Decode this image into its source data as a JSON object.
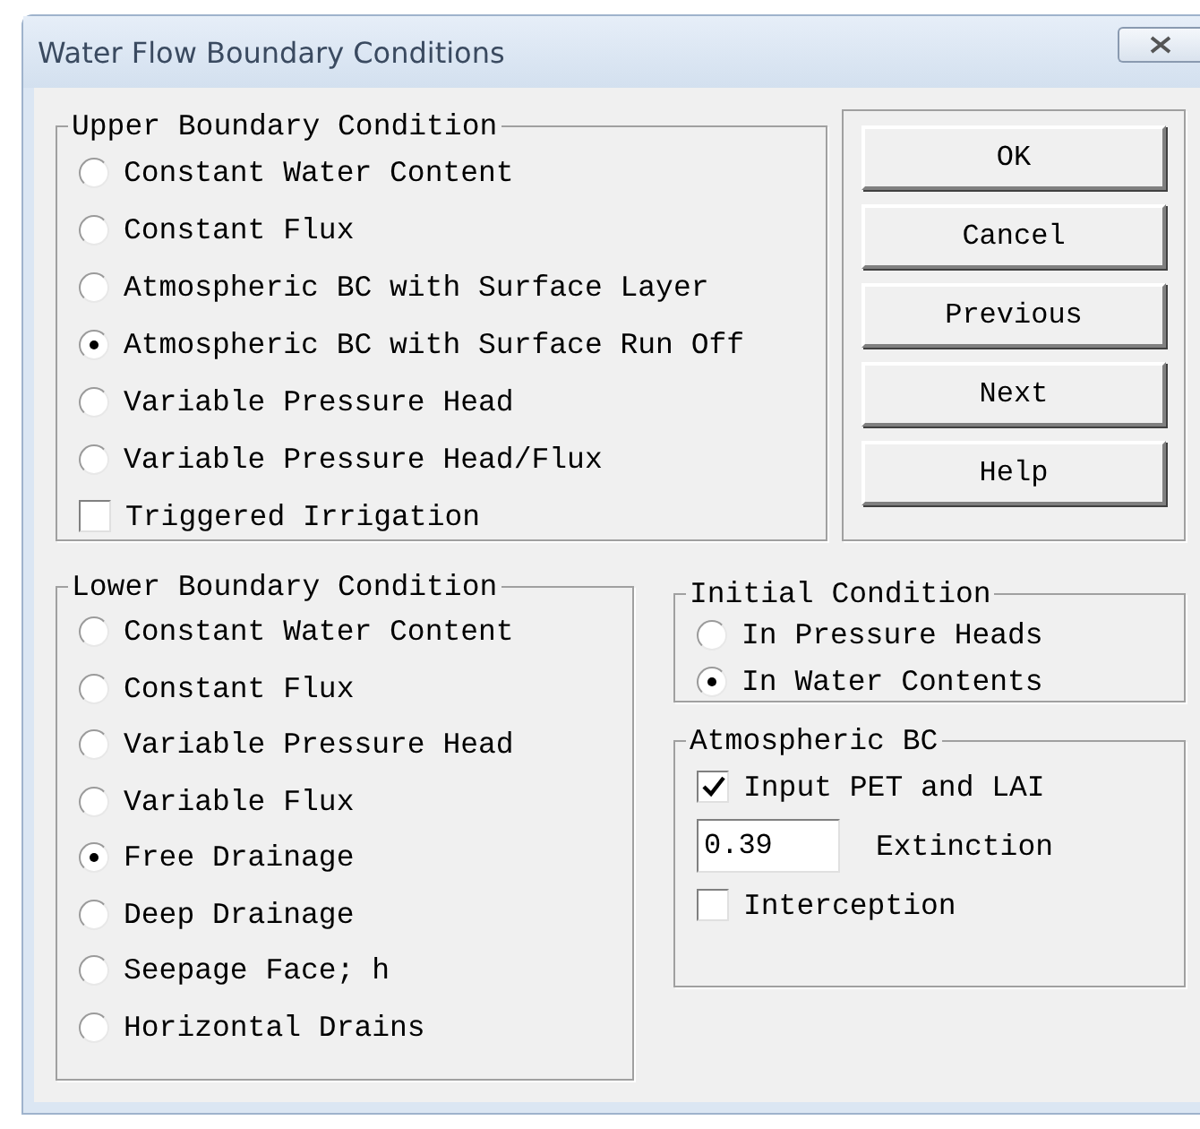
{
  "window": {
    "title": "Water Flow Boundary Conditions"
  },
  "upper_boundary": {
    "title": "Upper Boundary Condition",
    "options": [
      {
        "label": "Constant Water Content",
        "selected": false
      },
      {
        "label": "Constant Flux",
        "selected": false
      },
      {
        "label": "Atmospheric BC with Surface Layer",
        "selected": false
      },
      {
        "label": "Atmospheric BC with Surface Run Off",
        "selected": true
      },
      {
        "label": "Variable Pressure Head",
        "selected": false
      },
      {
        "label": "Variable Pressure Head/Flux",
        "selected": false
      }
    ],
    "triggered_irrigation": {
      "label": "Triggered Irrigation",
      "checked": false
    }
  },
  "buttons": [
    "OK",
    "Cancel",
    "Previous",
    "Next",
    "Help"
  ],
  "lower_boundary": {
    "title": "Lower Boundary Condition",
    "options": [
      {
        "label": "Constant Water Content",
        "selected": false
      },
      {
        "label": "Constant Flux",
        "selected": false
      },
      {
        "label": "Variable Pressure Head",
        "selected": false
      },
      {
        "label": "Variable Flux",
        "selected": false
      },
      {
        "label": "Free Drainage",
        "selected": true
      },
      {
        "label": "Deep Drainage",
        "selected": false
      },
      {
        "label": "Seepage Face; h",
        "selected": false
      },
      {
        "label": "Horizontal Drains",
        "selected": false
      }
    ]
  },
  "initial_condition": {
    "title": "Initial Condition",
    "options": [
      {
        "label": "In Pressure Heads",
        "selected": false
      },
      {
        "label": "In Water Contents",
        "selected": true
      }
    ]
  },
  "atmospheric_bc": {
    "title": "Atmospheric BC",
    "input_pet_lai": {
      "label": "Input PET and LAI",
      "checked": true
    },
    "extinction": {
      "value": "0.39",
      "label": "Extinction"
    },
    "interception": {
      "label": "Interception",
      "checked": false
    }
  }
}
